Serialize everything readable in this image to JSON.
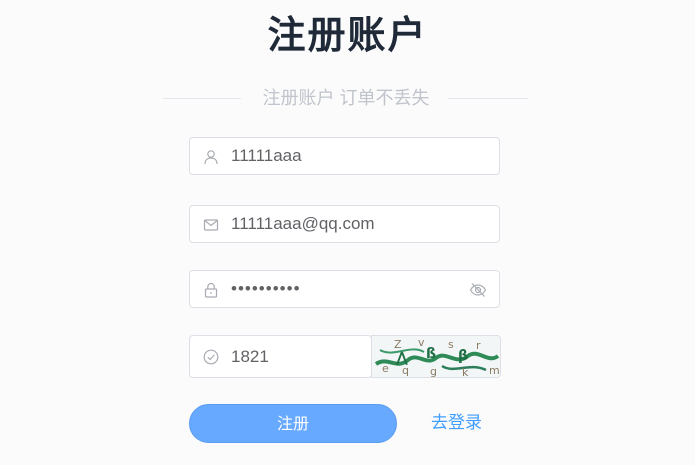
{
  "page": {
    "title": "注册账户",
    "subtitle": "注册账户 订单不丢失"
  },
  "form": {
    "username": {
      "value": "11111aaa",
      "icon": "user-icon"
    },
    "email": {
      "value": "11111aaa@qq.com",
      "icon": "mail-icon"
    },
    "password": {
      "value": "••••••••••",
      "icon": "lock-icon",
      "toggle_icon": "eye-off-icon"
    },
    "captcha": {
      "value": "1821",
      "icon": "check-circle-icon",
      "image": "captcha-image"
    }
  },
  "actions": {
    "register_label": "注册",
    "login_link_label": "去登录"
  },
  "colors": {
    "primary": "#409eff",
    "button": "#66a9ff",
    "title": "#1f2937",
    "muted": "#c0c4cc",
    "border": "#dcdfe6"
  }
}
